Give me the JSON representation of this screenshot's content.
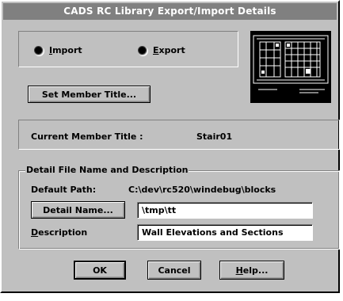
{
  "window": {
    "title": "CADS RC Library Export/Import Details"
  },
  "mode": {
    "import_label": "Import",
    "import_accel": "I",
    "import_rest": "mport",
    "export_label": "Export",
    "export_accel": "E",
    "export_rest": "xport",
    "selected": "Import"
  },
  "member": {
    "set_title_button": "Set Member Title...",
    "current_title_label": "Current Member Title :",
    "current_title_value": "Stair01"
  },
  "detail": {
    "group_label": "Detail File Name and Description",
    "default_path_label": "Default Path:",
    "default_path_value": "C:\\dev\\rc520\\windebug\\blocks",
    "detail_name_button": "Detail Name...",
    "detail_name_value": "\\tmp\\tt",
    "description_label": "Description",
    "description_accel": "D",
    "description_rest": "escription",
    "description_value": "Wall Elevations and Sections"
  },
  "buttons": {
    "ok": "OK",
    "cancel": "Cancel",
    "help": "Help...",
    "help_accel": "H",
    "help_rest": "elp..."
  },
  "colors": {
    "face": "#c0c0c0",
    "titlebar": "#808080",
    "preview_bg": "#000000"
  }
}
